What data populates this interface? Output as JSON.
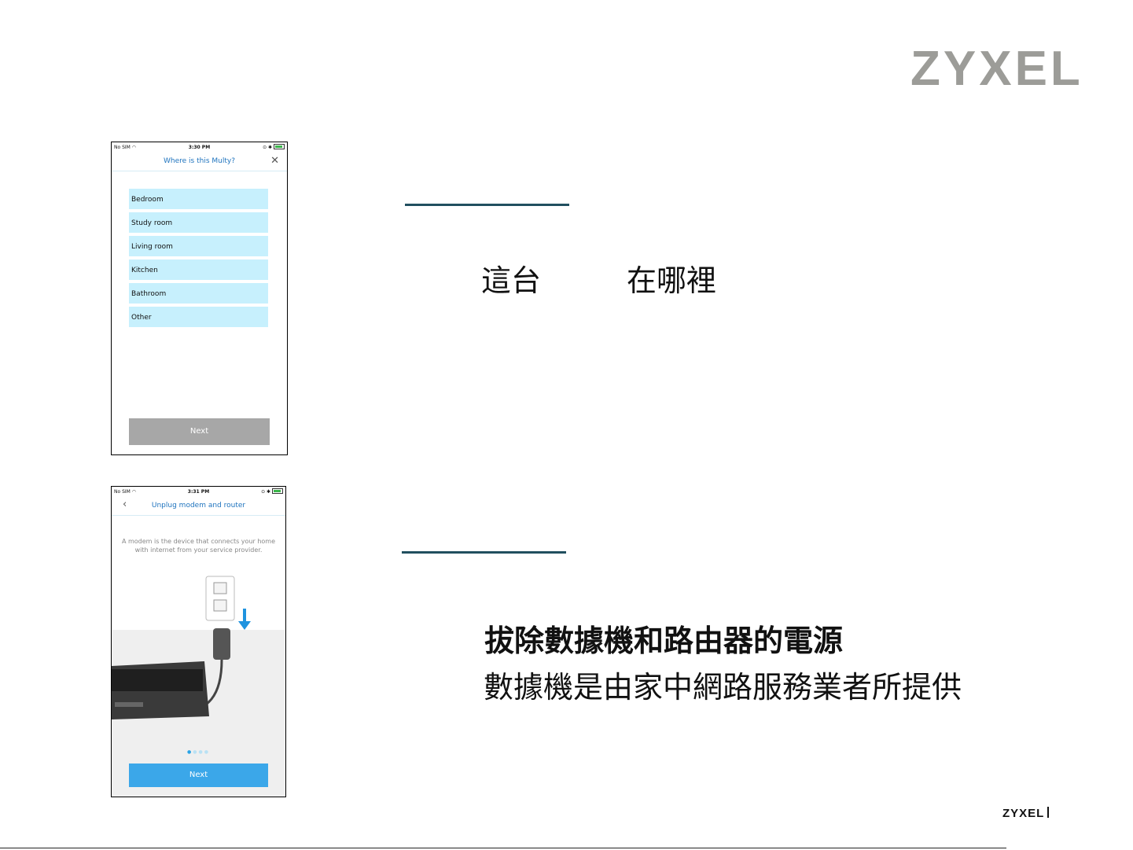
{
  "brand": {
    "logo_text": "ZYXEL"
  },
  "footer": {
    "logo_text": "ZYXEL"
  },
  "phone1": {
    "status": {
      "carrier": "No SIM",
      "time": "3:30 PM"
    },
    "title": "Where is this Multy?",
    "rooms": [
      "Bedroom",
      "Study room",
      "Living room",
      "Kitchen",
      "Bathroom",
      "Other"
    ],
    "next_label": "Next"
  },
  "phone2": {
    "status": {
      "carrier": "No SIM",
      "time": "3:31 PM"
    },
    "title": "Unplug modem and router",
    "description": "A modem is the device that connects your home with internet from your service provider.",
    "next_label": "Next",
    "page_indicator": {
      "pages": 4,
      "current": 1
    }
  },
  "slide": {
    "step1_text_a": "這台",
    "step1_text_b": "在哪裡",
    "step2_heading": "拔除數據機和路由器的電源",
    "step2_body": "數據機是由家中網路服務業者所提供"
  },
  "colors": {
    "accent_blue": "#3ba7e9",
    "list_bg": "#c7f0fd",
    "underline": "#214f5f",
    "logo_grey": "#9c9c98"
  }
}
